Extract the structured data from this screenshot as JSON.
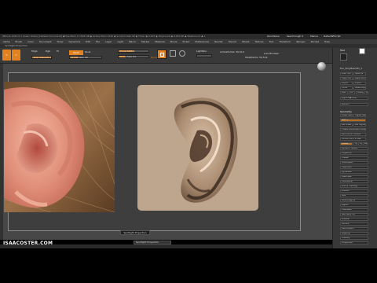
{
  "app": {
    "title_text": "ZBrush 2021.5.1 (Isaac Oster)  [Default Document]  ◆Free Mem 17.598 GB ◆ Active Mem 1020 ◆ Scratch Disk 90 ◆ Timer ◆ 0.037 ◆ PolyCount ◆ 0.050 KP ◆ MeshCount ◆ 1",
    "top_right": {
      "quicksave": "QuickSave",
      "see_through": "See-through 0",
      "menus": "Menus",
      "default_zscript": "DefaultZScript"
    }
  },
  "menu_bar": {
    "items": [
      "Alpha",
      "Brush",
      "Color",
      "Document",
      "Draw",
      "Dynamics",
      "Edit",
      "File",
      "Layer",
      "Light",
      "Macro",
      "Marker",
      "Material",
      "Movie",
      "Picker",
      "Preferences",
      "Render",
      "Stencil",
      "Stroke",
      "Texture",
      "Tool",
      "Transform",
      "Zplugin",
      "Zscript",
      "Help"
    ]
  },
  "subtitle": "Spotlight Projection",
  "shelf": {
    "edit_label": "Edit",
    "draw_label": "Draw",
    "rgb_label": "Rgb",
    "m_label": "M",
    "mrgb_label": "Mrgb",
    "zadd_label": "Zadd",
    "zsub_label": "Zsub",
    "rgb_intensity": {
      "label": "Rgb Intensity",
      "value": "100",
      "fraction": 1.0
    },
    "z_intensity": {
      "label": "Z Intensity",
      "value": "25",
      "fraction": 0.25
    },
    "focal_shift": {
      "label": "Focal Shift",
      "value": "0",
      "fraction": 0.5
    },
    "draw_size": {
      "label": "Draw Size",
      "value": "64",
      "fraction": 0.2
    },
    "dynamic_label": "Dynamic",
    "active_points": "ActivePoints: 50,514",
    "total_points": "TotalPoints: 50,514",
    "lightbox_label": "LightBox",
    "live_boolean": "Live Boolean"
  },
  "canvas": {
    "spotlight_button": "Spotlight Projection",
    "spotlight_dropdown": "Spotlight Projection",
    "watermark": "ISAACOSTER.COM"
  },
  "tray": {
    "header": "Tool",
    "load_tool": "Load Tool",
    "save_as": "Save As",
    "copy_tool": "Copy Tool",
    "paste_tool": "Paste Tool",
    "import": "Import",
    "export": "Export",
    "clone": "Clone",
    "make_polymesh": "Make PolyMesh3D",
    "goz": "GoZ",
    "all": "All",
    "visible": "Visible",
    "r_label": "R",
    "lightbox_tools": "Lightbox▶Tools",
    "tool_name": "Ear_PolyMesh3D_1",
    "subtool": "Subtool",
    "geometry": "Geometry",
    "lower_res": "Lower Res",
    "higher_res": "Higher Res",
    "sdiv": "SDiv 3",
    "del_lower": "Del Lower",
    "del_higher": "Del Higher",
    "freeze_subdiv": "Freeze SubDivision Levels",
    "reconstruct": "Reconstruct Subdiv",
    "convert_bpr": "Convert BPR To Geo",
    "divide": "Divide",
    "smt": "Smt",
    "suv": "Suv",
    "reuv": "ReUV",
    "dynamic_subdiv": "Dynamic Subdiv",
    "edgeloop": "EdgeLoop",
    "crease": "Crease",
    "shadowbox": "ShadowBox",
    "claypolish": "ClayPolish",
    "dynamesh": "DynaMesh",
    "tessimate": "Tessimate",
    "zremesher": "ZRemesher",
    "modify_topology": "Modify Topology",
    "position": "Position",
    "size": "Size",
    "meshintegrity": "MeshIntegrity",
    "layers": "Layers",
    "fibermesh": "FiberMesh",
    "geometry_hd": "Geometry HD",
    "preview": "Preview",
    "surface": "Surface",
    "deformation": "Deformation",
    "masking": "Masking",
    "visibility": "Visibility",
    "polygroups": "Polygroups",
    "contact": "Contact",
    "morph_target": "Morph Target",
    "polypaint": "Polypaint",
    "uv_map": "UV Map",
    "texture_map": "Texture Map",
    "displacement_map": "Displacement Map",
    "normal_map": "Normal Map",
    "vector_displacement": "Vector Displacement Map",
    "display_properties": "Display Properties",
    "unified_skin": "Unified Skin",
    "initialize": "Initialize",
    "import_sub": "Import",
    "export_sub": "Export",
    "dynamic_resolution": "Dynamic Resolution",
    "sdiv_fraction": 0.6
  },
  "colors": {
    "accent": "#e2811f",
    "canvas_bg": "#474747",
    "sculpt_bg": "#bda58e",
    "tray_bg": "#383838"
  },
  "icons": {
    "edit": "pencil-icon",
    "draw": "brush-icon",
    "material": "sphere-icon",
    "nav": "navigation-sphere-icon"
  }
}
